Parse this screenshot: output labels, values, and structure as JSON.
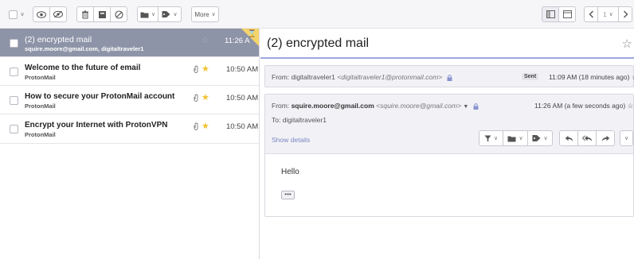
{
  "toolbar": {
    "more_label": "More",
    "pagination_label": "1"
  },
  "list": {
    "rows": [
      {
        "subject": "(2) encrypted mail",
        "sender": "squire.moore@gmail.com, digitaltraveler1",
        "time": "11:26 A",
        "selected": true
      },
      {
        "subject": "Welcome to the future of email",
        "sender": "ProtonMail",
        "time": "10:50 AM"
      },
      {
        "subject": "How to secure your ProtonMail account",
        "sender": "ProtonMail",
        "time": "10:50 AM"
      },
      {
        "subject": "Encrypt your Internet with ProtonVPN",
        "sender": "ProtonMail",
        "time": "10:50 AM"
      }
    ]
  },
  "reader": {
    "title": "(2) encrypted mail",
    "message1": {
      "from_label": "From:",
      "from_name": "digitaltraveler1",
      "from_email": "<digitaltraveler1@protonmail.com>",
      "badge": "Sent",
      "timestamp": "11:09 AM (18 minutes ago)"
    },
    "message2": {
      "from_label": "From:",
      "from_name": "squire.moore@gmail.com",
      "from_email": "<squire.moore@gmail.com>",
      "timestamp": "11:26 AM (a few seconds ago)",
      "to_label": "To:",
      "to_name": "digitaltraveler1",
      "show_details": "Show details",
      "body": "Hello",
      "expand": "•••"
    }
  },
  "colors": {
    "selected_row": "#8e94a8",
    "star": "#f2c230",
    "link": "#7a85c2",
    "title_underline": "#9ea8e0"
  },
  "icons": {
    "select_all": "checkbox-icon",
    "read": "eye-icon",
    "unread": "eye-slash-icon",
    "trash": "trash-icon",
    "archive": "archive-icon",
    "spam": "block-icon",
    "move": "folder-icon",
    "label": "tag-icon",
    "lock": "lock-icon"
  }
}
